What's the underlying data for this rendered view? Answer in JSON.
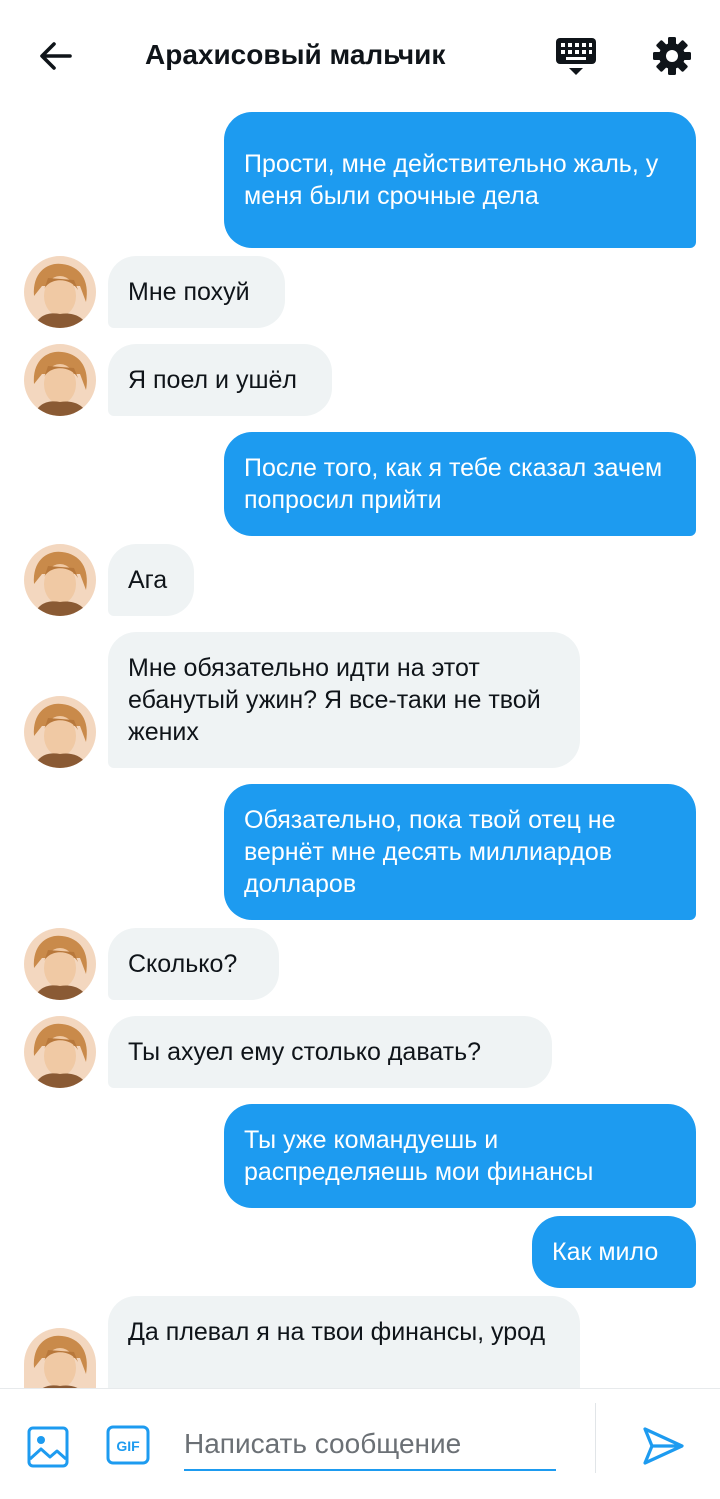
{
  "header": {
    "title": "Арахисовый мальчик",
    "icons": {
      "back": "arrow-left-icon",
      "keyboard": "keyboard-icon",
      "settings": "gear-icon"
    }
  },
  "messages": [
    {
      "side": "out",
      "text": "Прости, мне действительно жаль, у меня были срочные дела"
    },
    {
      "side": "in",
      "text": "Мне похуй"
    },
    {
      "side": "in",
      "text": "Я поел и ушёл"
    },
    {
      "side": "out",
      "text": "После того, как я тебе сказал зачем попросил прийти"
    },
    {
      "side": "in",
      "text": "Ага"
    },
    {
      "side": "in",
      "text": "Мне обязательно идти на этот ебанутый ужин? Я все-таки не твой жених"
    },
    {
      "side": "out",
      "text": "Обязательно, пока твой отец не вернёт мне десять миллиардов долларов"
    },
    {
      "side": "in",
      "text": "Сколько?"
    },
    {
      "side": "in",
      "text": "Ты ахуел ему столько давать?"
    },
    {
      "side": "out",
      "text": "Ты уже командуешь и распределяешь мои финансы"
    },
    {
      "side": "out",
      "text": "Как мило"
    },
    {
      "side": "in",
      "text": "Да плевал я на твои финансы, урод"
    }
  ],
  "composer": {
    "placeholder": "Написать сообщение",
    "value": "",
    "gif_label": "GIF",
    "icons": {
      "image": "image-icon",
      "gif": "gif-icon",
      "send": "send-icon"
    }
  },
  "colors": {
    "accent": "#1d9bf0",
    "incoming_bubble": "#eff3f4",
    "text": "#0f1419"
  }
}
